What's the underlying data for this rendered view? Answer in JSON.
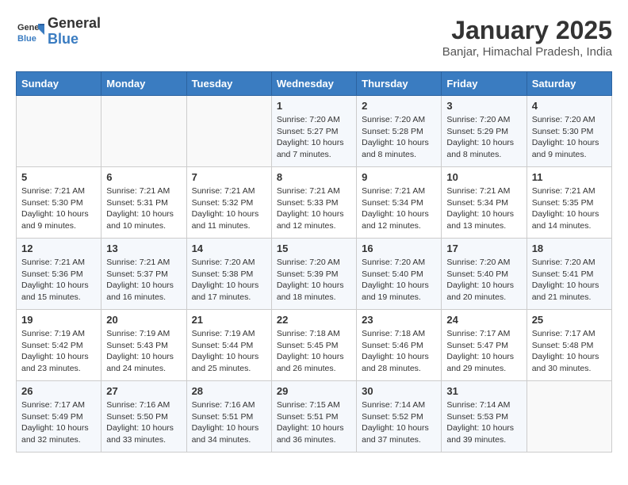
{
  "header": {
    "logo_line1": "General",
    "logo_line2": "Blue",
    "month": "January 2025",
    "location": "Banjar, Himachal Pradesh, India"
  },
  "days_of_week": [
    "Sunday",
    "Monday",
    "Tuesday",
    "Wednesday",
    "Thursday",
    "Friday",
    "Saturday"
  ],
  "weeks": [
    [
      {
        "num": "",
        "info": ""
      },
      {
        "num": "",
        "info": ""
      },
      {
        "num": "",
        "info": ""
      },
      {
        "num": "1",
        "info": "Sunrise: 7:20 AM\nSunset: 5:27 PM\nDaylight: 10 hours\nand 7 minutes."
      },
      {
        "num": "2",
        "info": "Sunrise: 7:20 AM\nSunset: 5:28 PM\nDaylight: 10 hours\nand 8 minutes."
      },
      {
        "num": "3",
        "info": "Sunrise: 7:20 AM\nSunset: 5:29 PM\nDaylight: 10 hours\nand 8 minutes."
      },
      {
        "num": "4",
        "info": "Sunrise: 7:20 AM\nSunset: 5:30 PM\nDaylight: 10 hours\nand 9 minutes."
      }
    ],
    [
      {
        "num": "5",
        "info": "Sunrise: 7:21 AM\nSunset: 5:30 PM\nDaylight: 10 hours\nand 9 minutes."
      },
      {
        "num": "6",
        "info": "Sunrise: 7:21 AM\nSunset: 5:31 PM\nDaylight: 10 hours\nand 10 minutes."
      },
      {
        "num": "7",
        "info": "Sunrise: 7:21 AM\nSunset: 5:32 PM\nDaylight: 10 hours\nand 11 minutes."
      },
      {
        "num": "8",
        "info": "Sunrise: 7:21 AM\nSunset: 5:33 PM\nDaylight: 10 hours\nand 12 minutes."
      },
      {
        "num": "9",
        "info": "Sunrise: 7:21 AM\nSunset: 5:34 PM\nDaylight: 10 hours\nand 12 minutes."
      },
      {
        "num": "10",
        "info": "Sunrise: 7:21 AM\nSunset: 5:34 PM\nDaylight: 10 hours\nand 13 minutes."
      },
      {
        "num": "11",
        "info": "Sunrise: 7:21 AM\nSunset: 5:35 PM\nDaylight: 10 hours\nand 14 minutes."
      }
    ],
    [
      {
        "num": "12",
        "info": "Sunrise: 7:21 AM\nSunset: 5:36 PM\nDaylight: 10 hours\nand 15 minutes."
      },
      {
        "num": "13",
        "info": "Sunrise: 7:21 AM\nSunset: 5:37 PM\nDaylight: 10 hours\nand 16 minutes."
      },
      {
        "num": "14",
        "info": "Sunrise: 7:20 AM\nSunset: 5:38 PM\nDaylight: 10 hours\nand 17 minutes."
      },
      {
        "num": "15",
        "info": "Sunrise: 7:20 AM\nSunset: 5:39 PM\nDaylight: 10 hours\nand 18 minutes."
      },
      {
        "num": "16",
        "info": "Sunrise: 7:20 AM\nSunset: 5:40 PM\nDaylight: 10 hours\nand 19 minutes."
      },
      {
        "num": "17",
        "info": "Sunrise: 7:20 AM\nSunset: 5:40 PM\nDaylight: 10 hours\nand 20 minutes."
      },
      {
        "num": "18",
        "info": "Sunrise: 7:20 AM\nSunset: 5:41 PM\nDaylight: 10 hours\nand 21 minutes."
      }
    ],
    [
      {
        "num": "19",
        "info": "Sunrise: 7:19 AM\nSunset: 5:42 PM\nDaylight: 10 hours\nand 23 minutes."
      },
      {
        "num": "20",
        "info": "Sunrise: 7:19 AM\nSunset: 5:43 PM\nDaylight: 10 hours\nand 24 minutes."
      },
      {
        "num": "21",
        "info": "Sunrise: 7:19 AM\nSunset: 5:44 PM\nDaylight: 10 hours\nand 25 minutes."
      },
      {
        "num": "22",
        "info": "Sunrise: 7:18 AM\nSunset: 5:45 PM\nDaylight: 10 hours\nand 26 minutes."
      },
      {
        "num": "23",
        "info": "Sunrise: 7:18 AM\nSunset: 5:46 PM\nDaylight: 10 hours\nand 28 minutes."
      },
      {
        "num": "24",
        "info": "Sunrise: 7:17 AM\nSunset: 5:47 PM\nDaylight: 10 hours\nand 29 minutes."
      },
      {
        "num": "25",
        "info": "Sunrise: 7:17 AM\nSunset: 5:48 PM\nDaylight: 10 hours\nand 30 minutes."
      }
    ],
    [
      {
        "num": "26",
        "info": "Sunrise: 7:17 AM\nSunset: 5:49 PM\nDaylight: 10 hours\nand 32 minutes."
      },
      {
        "num": "27",
        "info": "Sunrise: 7:16 AM\nSunset: 5:50 PM\nDaylight: 10 hours\nand 33 minutes."
      },
      {
        "num": "28",
        "info": "Sunrise: 7:16 AM\nSunset: 5:51 PM\nDaylight: 10 hours\nand 34 minutes."
      },
      {
        "num": "29",
        "info": "Sunrise: 7:15 AM\nSunset: 5:51 PM\nDaylight: 10 hours\nand 36 minutes."
      },
      {
        "num": "30",
        "info": "Sunrise: 7:14 AM\nSunset: 5:52 PM\nDaylight: 10 hours\nand 37 minutes."
      },
      {
        "num": "31",
        "info": "Sunrise: 7:14 AM\nSunset: 5:53 PM\nDaylight: 10 hours\nand 39 minutes."
      },
      {
        "num": "",
        "info": ""
      }
    ]
  ]
}
